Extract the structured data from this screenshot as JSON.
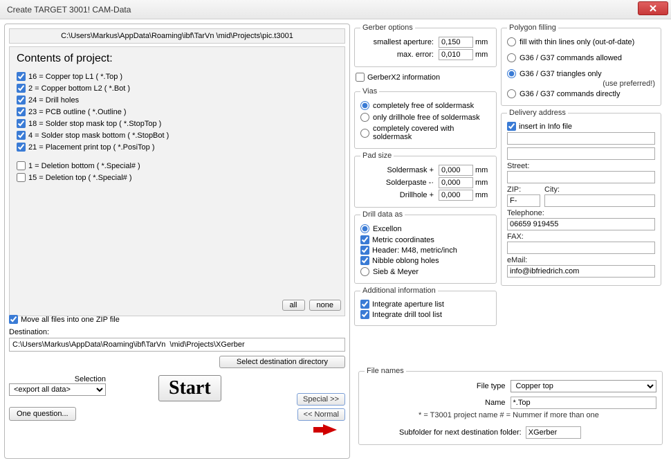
{
  "title": "Create TARGET 3001! CAM-Data",
  "path": "C:\\Users\\Markus\\AppData\\Roaming\\ibf\\TarVn  \\mid\\Projects\\pic.t3001",
  "contents_title": "Contents of project:",
  "layers": [
    {
      "checked": true,
      "label": "16 = Copper top L1   ( *.Top )"
    },
    {
      "checked": true,
      "label": "2 = Copper bottom L2   ( *.Bot )"
    },
    {
      "checked": true,
      "label": "24 = Drill holes"
    },
    {
      "checked": true,
      "label": "23 = PCB outline   ( *.Outline )"
    },
    {
      "checked": true,
      "label": "18 = Solder stop mask top   ( *.StopTop )"
    },
    {
      "checked": true,
      "label": "4 = Solder stop mask bottom   ( *.StopBot )"
    },
    {
      "checked": true,
      "label": "21 = Placement print top   ( *.PosiTop )"
    }
  ],
  "layers2": [
    {
      "checked": false,
      "label": "1 = Deletion bottom   ( *.Special# )"
    },
    {
      "checked": false,
      "label": "15 = Deletion top   ( *.Special# )"
    }
  ],
  "btn_all": "all",
  "btn_none": "none",
  "zip_label": "Move all files into one ZIP file",
  "dest_label": "Destination:",
  "dest_value": "C:\\Users\\Markus\\AppData\\Roaming\\ibf\\TarVn  \\mid\\Projects\\XGerber",
  "sel_dir": "Select destination directory",
  "selection_label": "Selection",
  "selection_value": "<export all data>",
  "one_q": "One question...",
  "start": "Start",
  "special": "Special >>",
  "normal": "<<  Normal",
  "gerber": {
    "legend": "Gerber options",
    "smallest": "smallest aperture:",
    "smallest_v": "0,150",
    "maxerr": "max. error:",
    "maxerr_v": "0,010",
    "mm": "mm",
    "gx2": "GerberX2 information"
  },
  "vias": {
    "legend": "Vias",
    "o1": "completely free of soldermask",
    "o2": "only drillhole free of soldermask",
    "o3": "completely covered with soldermask"
  },
  "pad": {
    "legend": "Pad size",
    "soldermask": "Soldermask  +",
    "solderpaste": "Solderpaste  -·",
    "drillhole": "Drillhole  +",
    "v": "0,000",
    "mm": "mm"
  },
  "drill": {
    "legend": "Drill data as",
    "excellon": "Excellon",
    "metric": "Metric coordinates",
    "header": "Header: M48, metric/inch",
    "nibble": "Nibble oblong holes",
    "sieb": "Sieb & Meyer"
  },
  "addl": {
    "legend": "Additional information",
    "aperture": "Integrate aperture list",
    "drilltool": "Integrate drill tool list"
  },
  "polygon": {
    "legend": "Polygon filling",
    "o1": "fill with thin lines only (out-of-date)",
    "o2": "G36 / G37 commands allowed",
    "o3": "G36 / G37 triangles only",
    "note": "(use preferred!)",
    "o4": "G36 / G37 commands directly"
  },
  "addr": {
    "legend": "Delivery address",
    "insert": "insert in Info file",
    "street": "Street:",
    "zip": "ZIP:",
    "zip_v": "F-",
    "city": "City:",
    "tel": "Telephone:",
    "tel_v": "06659 919455",
    "fax": "FAX:",
    "email": "eMail:",
    "email_v": "info@ibfriedrich.com"
  },
  "fnames": {
    "legend": "File names",
    "filetype": "File type",
    "filetype_v": "Copper top",
    "name": "Name",
    "name_v": "*.Top",
    "hint": "* = T3001 project name               # = Nummer if more than one",
    "sub": "Subfolder for next destination folder:",
    "sub_v": "XGerber"
  }
}
